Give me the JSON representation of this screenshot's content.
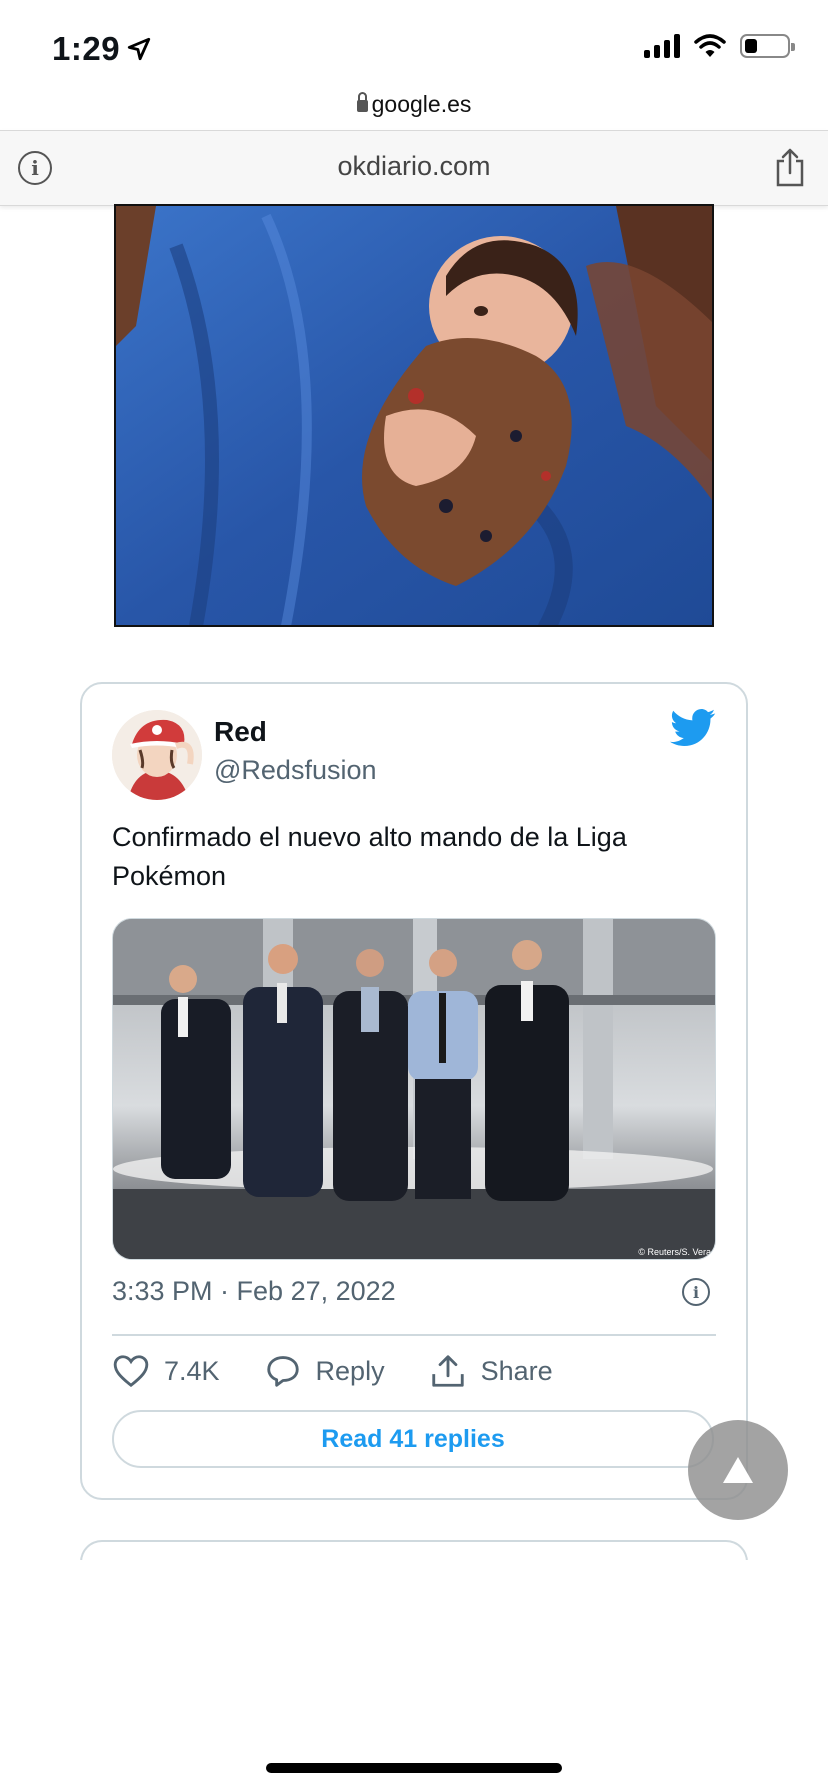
{
  "status_bar": {
    "time": "1:29",
    "icons": [
      "location-arrow-icon",
      "cellular-signal-icon",
      "wifi-icon",
      "battery-icon"
    ]
  },
  "browser": {
    "url": "google.es",
    "site_domain": "okdiario.com",
    "icons": [
      "lock-icon",
      "info-icon",
      "share-icon"
    ]
  },
  "tweet": {
    "author_name": "Red",
    "author_handle": "@Redsfusion",
    "text": "Confirmado el nuevo alto mando de la Liga Pokémon",
    "media_credit": "© Reuters/S. Vera",
    "timestamp": "3:33 PM · Feb 27, 2022",
    "likes": "7.4K",
    "reply_label": "Reply",
    "share_label": "Share",
    "read_replies_label": "Read 41 replies",
    "colors": {
      "accent": "#1d9bf0",
      "muted": "#536471",
      "border": "#cfd9de"
    }
  },
  "scroll_top": {
    "icon": "triangle-up-icon"
  }
}
